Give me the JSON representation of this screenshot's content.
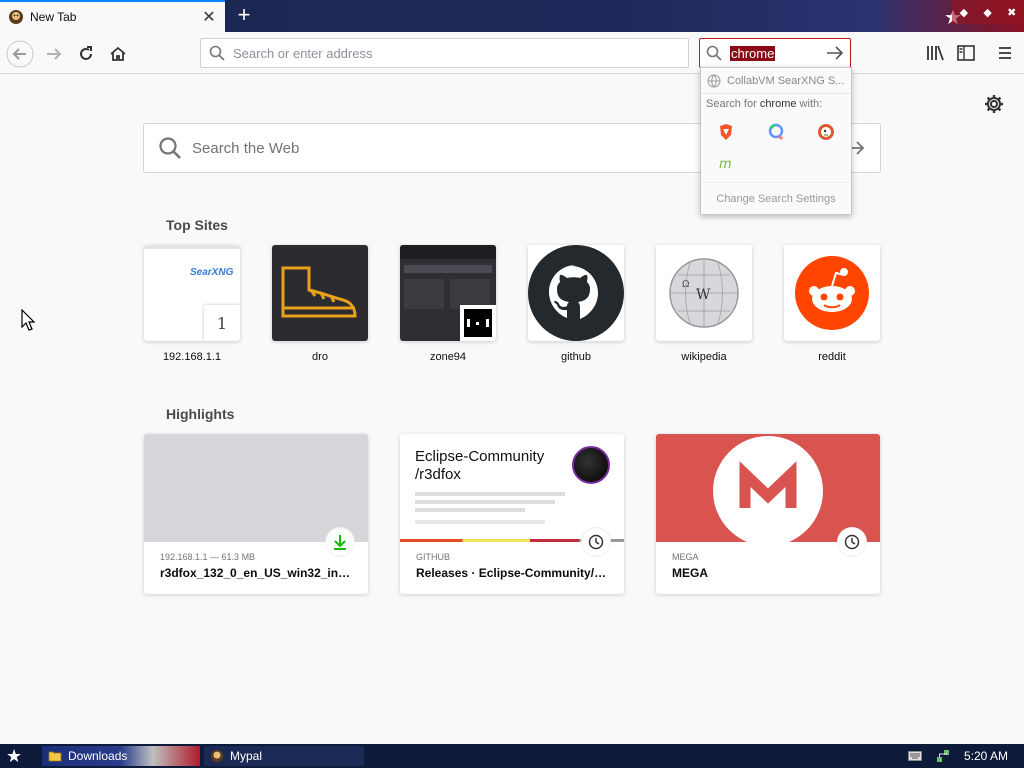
{
  "tab": {
    "title": "New Tab",
    "close": "✕"
  },
  "toolbar": {
    "url_placeholder": "Search or enter address",
    "search_value": "chrome"
  },
  "search_popup": {
    "engine": "CollabVM SearXNG S...",
    "search_for_prefix": "Search for ",
    "query": "chrome",
    "search_for_suffix": " with:",
    "settings_label": "Change Search Settings",
    "engines": [
      "brave-icon",
      "qwant-icon",
      "duckduckgo-icon",
      "mojeek-icon"
    ]
  },
  "web_search": {
    "placeholder": "Search the Web"
  },
  "top_sites": {
    "title": "Top Sites",
    "sites": [
      {
        "label": "192.168.1.1",
        "thumb_text": "SearXNG",
        "pin_number": "1"
      },
      {
        "label": "dro"
      },
      {
        "label": "zone94"
      },
      {
        "label": "github"
      },
      {
        "label": "wikipedia"
      },
      {
        "label": "reddit"
      }
    ]
  },
  "highlights": {
    "title": "Highlights",
    "items": [
      {
        "meta": "192.168.1.1 — 61.3 MB",
        "title": "r3dfox_132_0_en_US_win32_inst...",
        "badge": "download-icon"
      },
      {
        "meta": "GITHUB",
        "title": "Releases · Eclipse-Community/r3...",
        "thumb_title": "Eclipse-Community /r3dfox",
        "badge": "clock-icon"
      },
      {
        "meta": "MEGA",
        "title": "MEGA",
        "badge": "clock-icon"
      }
    ]
  },
  "taskbar": {
    "downloads_label": "Downloads",
    "mypal_label": "Mypal",
    "clock": "5:20 AM"
  },
  "colors": {
    "accent": "#0a84ff",
    "search_highlight": "#8b0a16",
    "reddit": "#ff4500",
    "mega": "#d9534f"
  }
}
